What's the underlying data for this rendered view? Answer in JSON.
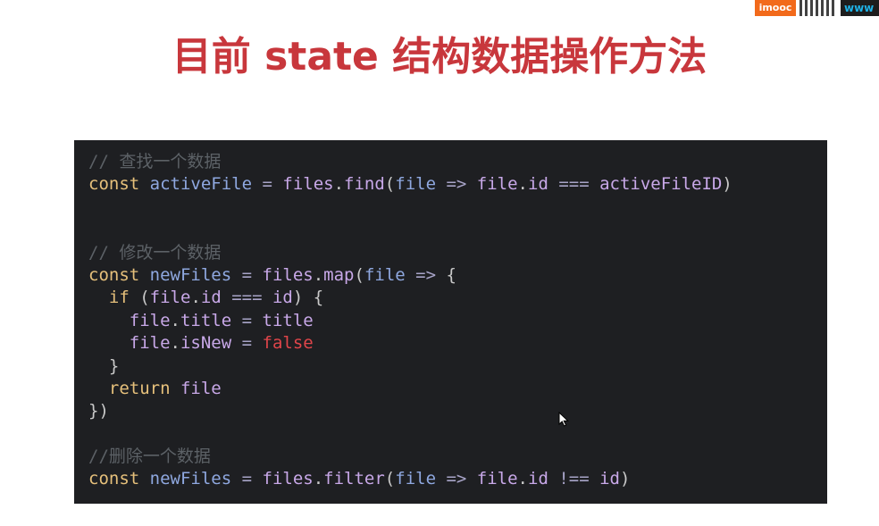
{
  "branding": {
    "logo_text": "imooc",
    "site_text": "www"
  },
  "slide": {
    "title": "目前 state 结构数据操作方法"
  },
  "code": {
    "lines": [
      [
        {
          "t": "// 查找一个数据",
          "c": "comment"
        }
      ],
      [
        {
          "t": "const",
          "c": "keyword"
        },
        {
          "t": " ",
          "c": "punct"
        },
        {
          "t": "activeFile",
          "c": "var"
        },
        {
          "t": " = ",
          "c": "op"
        },
        {
          "t": "files",
          "c": "ident"
        },
        {
          "t": ".",
          "c": "punct"
        },
        {
          "t": "find",
          "c": "ident"
        },
        {
          "t": "(",
          "c": "punct"
        },
        {
          "t": "file",
          "c": "var"
        },
        {
          "t": " => ",
          "c": "op"
        },
        {
          "t": "file",
          "c": "ident"
        },
        {
          "t": ".",
          "c": "punct"
        },
        {
          "t": "id",
          "c": "ident"
        },
        {
          "t": " === ",
          "c": "op"
        },
        {
          "t": "activeFileID",
          "c": "ident"
        },
        {
          "t": ")",
          "c": "punct"
        }
      ],
      [],
      [],
      [
        {
          "t": "// 修改一个数据",
          "c": "comment"
        }
      ],
      [
        {
          "t": "const",
          "c": "keyword"
        },
        {
          "t": " ",
          "c": "punct"
        },
        {
          "t": "newFiles",
          "c": "var"
        },
        {
          "t": " = ",
          "c": "op"
        },
        {
          "t": "files",
          "c": "ident"
        },
        {
          "t": ".",
          "c": "punct"
        },
        {
          "t": "map",
          "c": "ident"
        },
        {
          "t": "(",
          "c": "punct"
        },
        {
          "t": "file",
          "c": "var"
        },
        {
          "t": " => ",
          "c": "op"
        },
        {
          "t": "{",
          "c": "punct"
        }
      ],
      [
        {
          "t": "  ",
          "c": "punct"
        },
        {
          "t": "if",
          "c": "keyword"
        },
        {
          "t": " (",
          "c": "punct"
        },
        {
          "t": "file",
          "c": "ident"
        },
        {
          "t": ".",
          "c": "punct"
        },
        {
          "t": "id",
          "c": "ident"
        },
        {
          "t": " === ",
          "c": "op"
        },
        {
          "t": "id",
          "c": "ident"
        },
        {
          "t": ") {",
          "c": "punct"
        }
      ],
      [
        {
          "t": "    ",
          "c": "punct"
        },
        {
          "t": "file",
          "c": "ident"
        },
        {
          "t": ".",
          "c": "punct"
        },
        {
          "t": "title",
          "c": "ident"
        },
        {
          "t": " = ",
          "c": "op"
        },
        {
          "t": "title",
          "c": "ident"
        }
      ],
      [
        {
          "t": "    ",
          "c": "punct"
        },
        {
          "t": "file",
          "c": "ident"
        },
        {
          "t": ".",
          "c": "punct"
        },
        {
          "t": "isNew",
          "c": "ident"
        },
        {
          "t": " = ",
          "c": "op"
        },
        {
          "t": "false",
          "c": "bool"
        }
      ],
      [
        {
          "t": "  }",
          "c": "punct"
        }
      ],
      [
        {
          "t": "  ",
          "c": "punct"
        },
        {
          "t": "return",
          "c": "keyword"
        },
        {
          "t": " ",
          "c": "punct"
        },
        {
          "t": "file",
          "c": "ident"
        }
      ],
      [
        {
          "t": "})",
          "c": "punct"
        }
      ],
      [],
      [
        {
          "t": "//删除一个数据",
          "c": "comment"
        }
      ],
      [
        {
          "t": "const",
          "c": "keyword"
        },
        {
          "t": " ",
          "c": "punct"
        },
        {
          "t": "newFiles",
          "c": "var"
        },
        {
          "t": " = ",
          "c": "op"
        },
        {
          "t": "files",
          "c": "ident"
        },
        {
          "t": ".",
          "c": "punct"
        },
        {
          "t": "filter",
          "c": "ident"
        },
        {
          "t": "(",
          "c": "punct"
        },
        {
          "t": "file",
          "c": "var"
        },
        {
          "t": " => ",
          "c": "op"
        },
        {
          "t": "file",
          "c": "ident"
        },
        {
          "t": ".",
          "c": "punct"
        },
        {
          "t": "id",
          "c": "ident"
        },
        {
          "t": " !== ",
          "c": "op"
        },
        {
          "t": "id",
          "c": "ident"
        },
        {
          "t": ")",
          "c": "punct"
        }
      ]
    ]
  },
  "icons": {
    "mouse_cursor": "arrow-cursor-icon"
  }
}
